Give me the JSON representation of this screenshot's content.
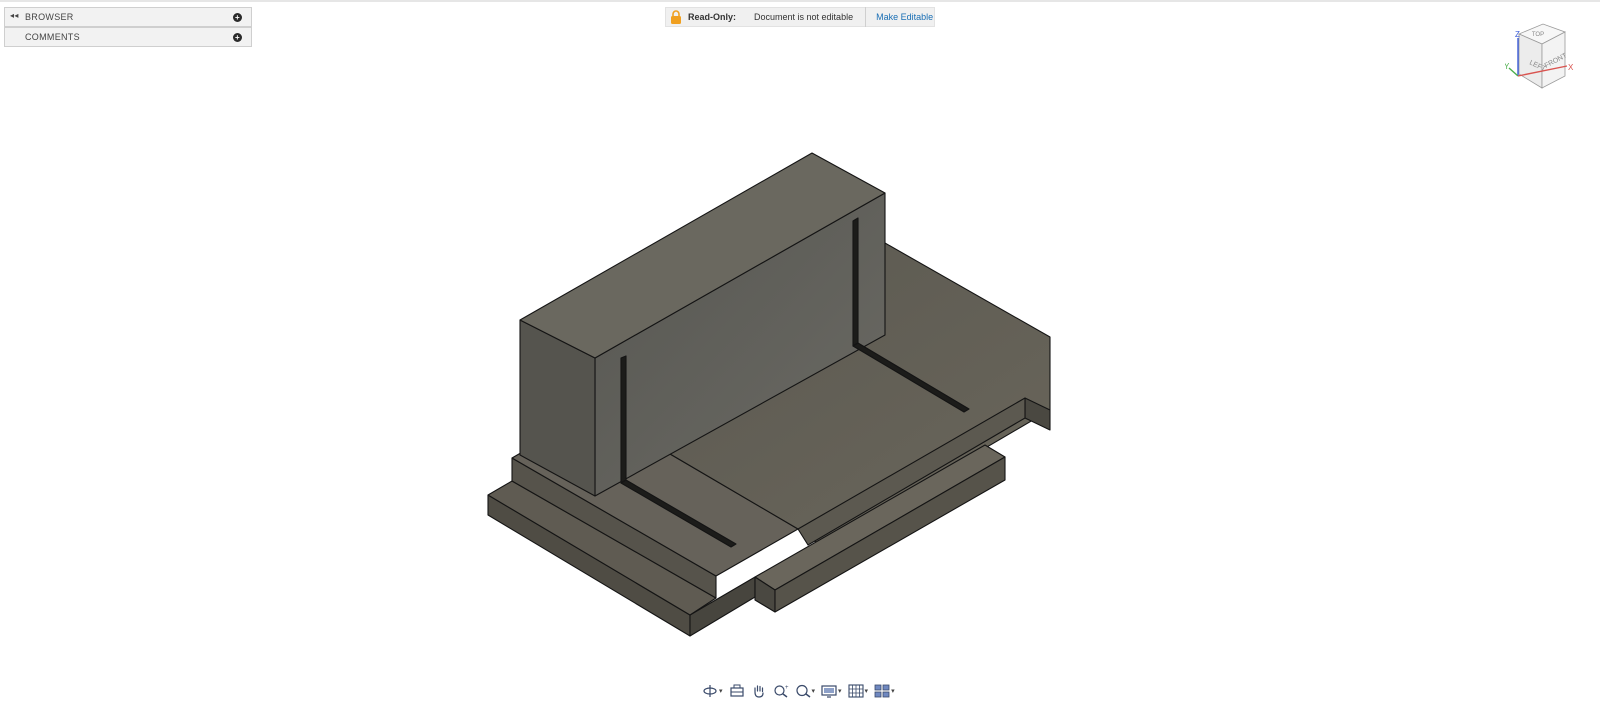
{
  "panels": {
    "browser_label": "BROWSER",
    "comments_label": "COMMENTS"
  },
  "banner": {
    "read_only_label": "Read-Only:",
    "status_text": "Document is not editable",
    "make_editable_label": "Make Editable"
  },
  "viewcube": {
    "top_label": "TOP",
    "left_label": "LEFT",
    "front_label": "FRONT",
    "axis_z": "Z",
    "axis_x": "X",
    "axis_y": "Y"
  },
  "toolbar": {
    "items": [
      {
        "name": "orbit",
        "icon": "orbit-icon",
        "dropdown": true
      },
      {
        "name": "look-at",
        "icon": "look-at-icon",
        "dropdown": false
      },
      {
        "name": "pan",
        "icon": "hand-icon",
        "dropdown": false
      },
      {
        "name": "zoom",
        "icon": "zoom-icon",
        "dropdown": false
      },
      {
        "name": "fit",
        "icon": "zoom-window-icon",
        "dropdown": true
      },
      {
        "name": "display-settings",
        "icon": "monitor-icon",
        "dropdown": true
      },
      {
        "name": "grid-snaps",
        "icon": "grid-icon",
        "dropdown": true
      },
      {
        "name": "viewports",
        "icon": "viewports-icon",
        "dropdown": true
      }
    ]
  },
  "colors": {
    "accent": "#1a6fb5",
    "model_fill": "#5f5b52",
    "lock": "#f0a020"
  }
}
